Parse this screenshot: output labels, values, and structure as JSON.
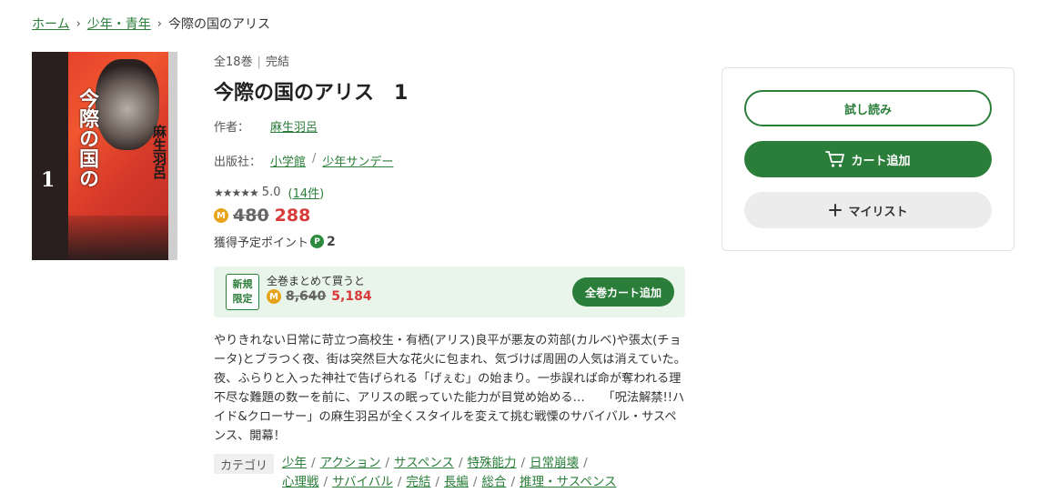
{
  "breadcrumb": {
    "home": "ホーム",
    "category": "少年・青年",
    "current": "今際の国のアリス"
  },
  "cover": {
    "title_vertical": "今際の国の",
    "author_vertical": "麻生羽呂",
    "volume": "1"
  },
  "book": {
    "volumes": "全18巻",
    "status": "完結",
    "title": "今際の国のアリス　1",
    "author_label": "作者：",
    "author": "麻生羽呂",
    "publisher_label": "出版社：",
    "publisher": "小学館",
    "label": "少年サンデー",
    "stars": "★★★★★",
    "rating": "5.0",
    "reviews": "14件",
    "price_old": "480",
    "price_new": "288",
    "points_label": "獲得予定ポイント",
    "points": "2"
  },
  "bundle": {
    "badge_line1": "新規",
    "badge_line2": "限定",
    "title": "全巻まとめて買うと",
    "price_old": "8,640",
    "price_new": "5,184",
    "button": "全巻カート追加"
  },
  "description": "やりきれない日常に苛立つ高校生・有栖(アリス)良平が悪友の苅部(カルベ)や張太(チョータ)とブラつく夜、街は突然巨大な花火に包まれ、気づけば周囲の人気は消えていた。　夜、ふらりと入った神社で告げられる「げぇむ」の始まり。一歩誤れば命が奪われる理不尽な難題の数ーを前に、アリスの眠っていた能力が目覚め始める…　　「呪法解禁!!ハイド&クローサー」の麻生羽呂が全くスタイルを変えて挑む戦慄のサバイバル・サスペンス、開幕！",
  "categories": {
    "label": "カテゴリ",
    "items": [
      "少年",
      "アクション",
      "サスペンス",
      "特殊能力",
      "日常崩壊",
      "心理戦",
      "サバイバル",
      "完結",
      "長編",
      "総合",
      "推理・サスペンス"
    ]
  },
  "actions": {
    "trial": "試し読み",
    "cart": "カート追加",
    "mylist": "マイリスト"
  },
  "colors": {
    "accent": "#2b7d3a",
    "price": "#d83a3a",
    "coin": "#e9a31a"
  }
}
